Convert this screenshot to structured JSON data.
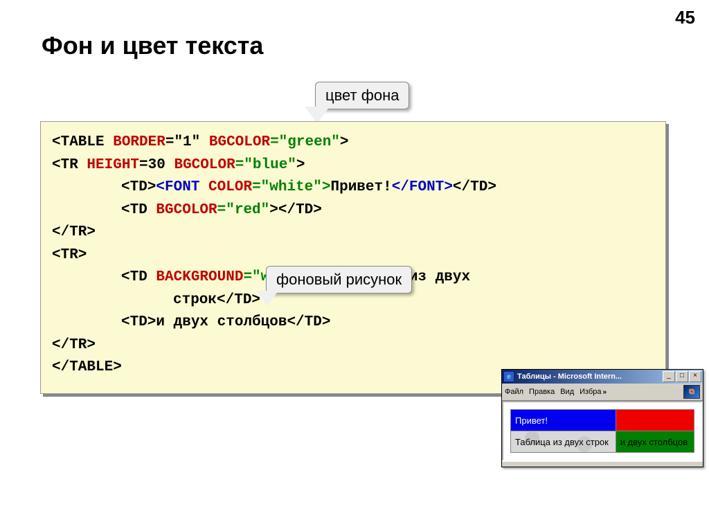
{
  "page_number": "45",
  "title": "Фон и цвет текста",
  "callouts": {
    "bgcolor": "цвет фона",
    "background_image": "фоновый рисунок"
  },
  "code": {
    "l1": {
      "pre": "<TABLE ",
      "a1": "BORDER",
      "v1": "=\"1\" ",
      "a2": "BGCOLOR",
      "v2": "=\"green\"",
      "suf": ">"
    },
    "l2": {
      "pre": "<TR ",
      "a1": "HEIGHT",
      "v1": "=30 ",
      "a2": "BGCOLOR",
      "v2": "=\"blue\"",
      "suf": ">"
    },
    "l3": {
      "pre": "<TD>",
      "open": "<FONT ",
      "attr": "COLOR",
      "val": "=\"white\">",
      "txt": "Привет!",
      "close": "</FONT>",
      "suf": "</TD>"
    },
    "l4": {
      "pre": "<TD ",
      "attr": "BGCOLOR",
      "val": "=\"red\"",
      "suf": "></TD>"
    },
    "l5": "</TR>",
    "l6": "<TR>",
    "l7": {
      "pre": "<TD ",
      "attr": "BACKGROUND",
      "val": "=\"web.jpg\">",
      "txt": "Таблица из двух"
    },
    "l7b": {
      "txt": "строк",
      "suf": "</TD>"
    },
    "l8": {
      "pre": "<TD>",
      "txt": "и двух столбцов",
      "suf": "</TD>"
    },
    "l9": "</TR>",
    "l10": "</TABLE>"
  },
  "browser": {
    "title": "Таблицы - Microsoft Intern...",
    "menu": {
      "file": "Файл",
      "edit": "Правка",
      "view": "Вид",
      "fav": "Избра",
      "chev": "»"
    },
    "table": {
      "r1c1": "Привет!",
      "r2c1": "Таблица из двух строк",
      "r2c2": "и двух столбцов"
    }
  },
  "icons": {
    "min": "_",
    "max": "□",
    "close": "×",
    "ie": "e"
  }
}
